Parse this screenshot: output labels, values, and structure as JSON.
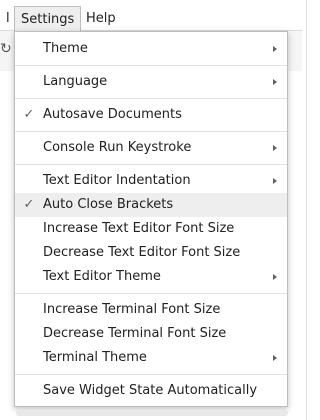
{
  "menubar": {
    "items": [
      {
        "label": "l"
      },
      {
        "label": "Settings"
      },
      {
        "label": "Help"
      }
    ]
  },
  "settings_menu": {
    "items": [
      {
        "label": "Theme",
        "checked": false,
        "submenu": true
      },
      {
        "label": "Language",
        "checked": false,
        "submenu": true
      },
      {
        "label": "Autosave Documents",
        "checked": true,
        "submenu": false
      },
      {
        "label": "Console Run Keystroke",
        "checked": false,
        "submenu": true
      },
      {
        "label": "Text Editor Indentation",
        "checked": false,
        "submenu": true
      },
      {
        "label": "Auto Close Brackets",
        "checked": true,
        "submenu": false,
        "highlighted": true
      },
      {
        "label": "Increase Text Editor Font Size",
        "checked": false,
        "submenu": false
      },
      {
        "label": "Decrease Text Editor Font Size",
        "checked": false,
        "submenu": false
      },
      {
        "label": "Text Editor Theme",
        "checked": false,
        "submenu": true
      },
      {
        "label": "Increase Terminal Font Size",
        "checked": false,
        "submenu": false
      },
      {
        "label": "Decrease Terminal Font Size",
        "checked": false,
        "submenu": false
      },
      {
        "label": "Terminal Theme",
        "checked": false,
        "submenu": true
      },
      {
        "label": "Save Widget State Automatically",
        "checked": false,
        "submenu": false
      }
    ]
  },
  "icons": {
    "check": "checkmark-icon",
    "submenu": "chevron-right-icon",
    "refresh": "refresh-icon"
  }
}
